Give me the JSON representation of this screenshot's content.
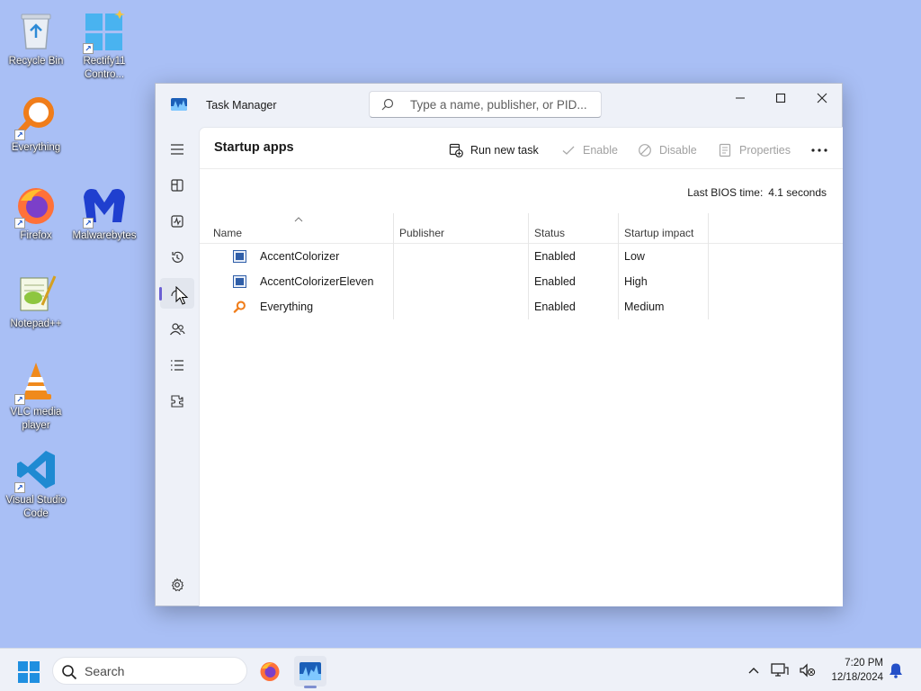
{
  "desktop": {
    "icons": [
      {
        "label": "Recycle Bin"
      },
      {
        "label": "Rectify11 Contro..."
      },
      {
        "label": "Everything"
      },
      {
        "label": "Firefox"
      },
      {
        "label": "Malwarebytes"
      },
      {
        "label": "Notepad++"
      },
      {
        "label": "VLC media player"
      },
      {
        "label": "Visual Studio Code"
      }
    ]
  },
  "window": {
    "title": "Task Manager",
    "search_placeholder": "Type a name, publisher, or PID...",
    "page_title": "Startup apps",
    "commands": {
      "run_new_task": "Run new task",
      "enable": "Enable",
      "disable": "Disable",
      "properties": "Properties"
    },
    "bios_label": "Last BIOS time:",
    "bios_value": "4.1 seconds",
    "table": {
      "columns": [
        "Name",
        "Publisher",
        "Status",
        "Startup impact"
      ],
      "rows": [
        {
          "name": "AccentColorizer",
          "publisher": "",
          "status": "Enabled",
          "impact": "Low"
        },
        {
          "name": "AccentColorizerEleven",
          "publisher": "",
          "status": "Enabled",
          "impact": "High"
        },
        {
          "name": "Everything",
          "publisher": "",
          "status": "Enabled",
          "impact": "Medium"
        }
      ]
    }
  },
  "taskbar": {
    "search_label": "Search",
    "time": "7:20 PM",
    "date": "12/18/2024"
  },
  "colors": {
    "desktop_bg": "#a9bff5",
    "accent": "#6b5fd3"
  }
}
